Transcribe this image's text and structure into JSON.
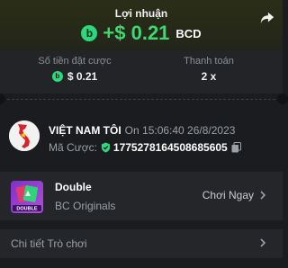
{
  "colors": {
    "profit_green": "#3bd96e",
    "coin_green": "#2dd77b",
    "panel": "#232427",
    "card": "#25262a",
    "background": "#1b1c1f",
    "muted_text": "#9aa0a6"
  },
  "header": {
    "title": "Lợi nhuận",
    "profit_value": "+$ 0.21",
    "currency": "BCD",
    "share_icon": "share-arrow-icon"
  },
  "stats": {
    "bet_amount_label": "Số tiền đặt cược",
    "bet_amount_value": "$ 0.21",
    "payout_label": "Thanh toán",
    "payout_value": "2 x"
  },
  "bet": {
    "username": "VIỆT NAM TÔI",
    "on_text": "On 15:06:40 26/8/2023",
    "bet_id_label": "Mã Cược:",
    "bet_id": "1775278164508685605"
  },
  "game": {
    "name": "Double",
    "provider": "BC Originals",
    "play_label": "Chơi Ngay",
    "thumb_text": "DOUBLE"
  },
  "details": {
    "label": "Chi tiết Trò chơi"
  }
}
